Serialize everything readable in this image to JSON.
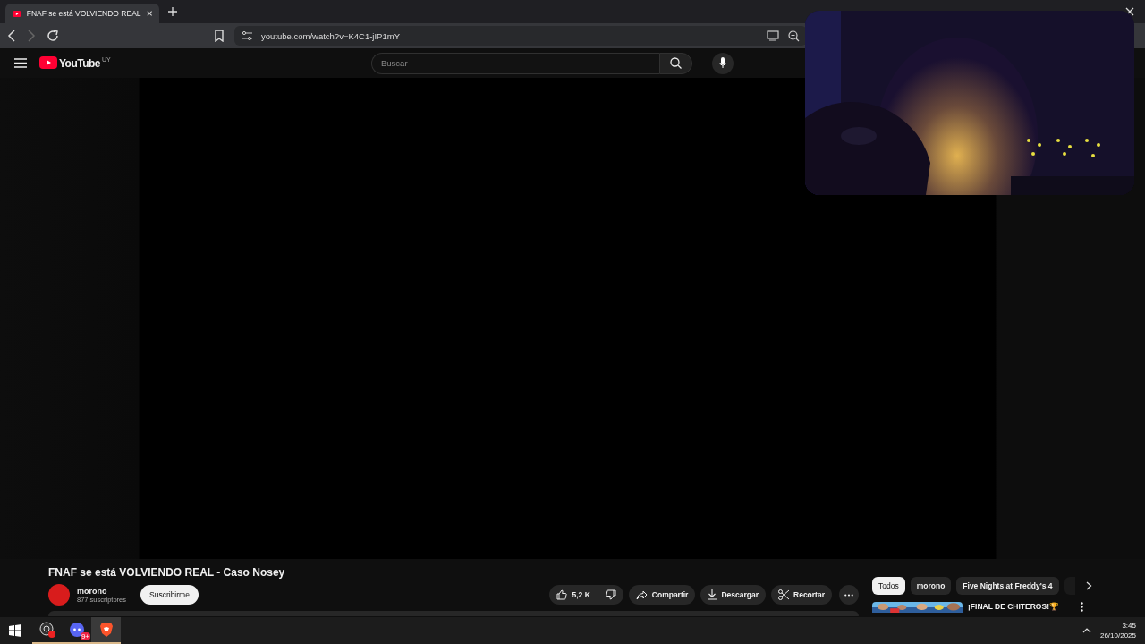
{
  "browser": {
    "tabs": [
      {
        "title": "FNAF se está VOLVIENDO REAL",
        "selected": true
      }
    ],
    "url": "youtube.com/watch?v=K4C1-jIP1mY"
  },
  "header": {
    "logo": "YouTube",
    "region": "UY",
    "search": {
      "placeholder": "Buscar"
    }
  },
  "video": {
    "title": "FNAF se está VOLVIENDO REAL - Caso Nosey",
    "channel": "morono",
    "subscribers": "877 suscriptores",
    "subscribe": "Suscribirme",
    "likes": "5,2 K",
    "actions": [
      {
        "label": "Compartir",
        "kind": "share"
      },
      {
        "label": "Descargar",
        "kind": "download"
      },
      {
        "label": "Recortar",
        "kind": "clip"
      }
    ]
  },
  "chips": [
    {
      "label": "Todos",
      "selected": true
    },
    {
      "label": "morono",
      "selected": false
    },
    {
      "label": "Five Nights at Freddy's 4",
      "selected": false
    }
  ],
  "recommended": [
    {
      "title": "¡FINAL DE CHITEROS!🏆"
    }
  ],
  "taskbar": {
    "apps": [
      {
        "kind": "recorder",
        "selected": false
      },
      {
        "kind": "chat",
        "badge": "9+",
        "selected": false
      },
      {
        "kind": "browser",
        "selected": true
      }
    ],
    "time": "3:45",
    "date": "26/10/2025"
  }
}
